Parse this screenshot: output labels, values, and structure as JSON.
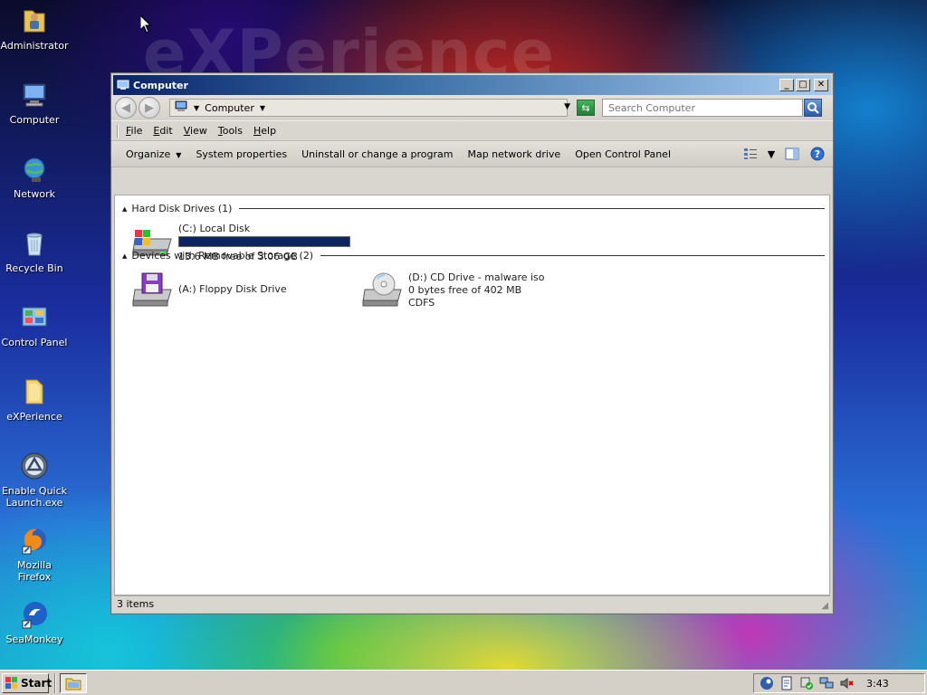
{
  "desktop": {
    "wallpaper_text": "eXPerience",
    "icons": [
      {
        "label": "Administrator"
      },
      {
        "label": "Computer"
      },
      {
        "label": "Network"
      },
      {
        "label": "Recycle Bin"
      },
      {
        "label": "Control Panel"
      },
      {
        "label": "eXPerience"
      },
      {
        "label": "Enable Quick Launch.exe"
      },
      {
        "label": "Mozilla Firefox"
      },
      {
        "label": "SeaMonkey"
      }
    ]
  },
  "window": {
    "title": "Computer",
    "controls": {
      "minimize": "_",
      "maximize": "□",
      "close": "✕"
    },
    "address": {
      "crumb": "Computer"
    },
    "search": {
      "placeholder": "Search Computer"
    },
    "menu": [
      "File",
      "Edit",
      "View",
      "Tools",
      "Help"
    ],
    "commands": {
      "organize": "Organize",
      "system_properties": "System properties",
      "uninstall": "Uninstall or change a program",
      "map_drive": "Map network drive",
      "control_panel": "Open Control Panel"
    },
    "groups": {
      "hard_disks": "Hard Disk Drives (1)",
      "removable": "Devices with Removable Storage (2)"
    },
    "drives": {
      "c": {
        "name": "(C:) Local Disk",
        "free": "13.6 MB free of 3.06 GB",
        "used_fraction": 0.996
      },
      "a": {
        "name": "(A:) Floppy Disk Drive"
      },
      "d": {
        "name": "(D:) CD Drive - malware iso",
        "free": "0 bytes free of 402 MB",
        "fs": "CDFS"
      }
    },
    "status": "3 items"
  },
  "taskbar": {
    "start_label": "Start",
    "clock": "3:43"
  },
  "colors": {
    "titlebar_start": "#0a246a",
    "capacity_bar": "#0c2460"
  }
}
